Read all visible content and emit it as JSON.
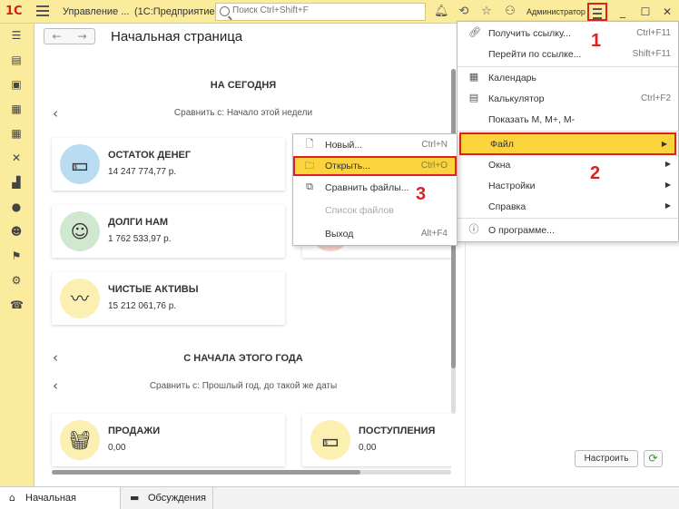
{
  "titlebar": {
    "app_name": "Управление ...",
    "app_platform": "(1С:Предприятие)",
    "search_placeholder": "Поиск Ctrl+Shift+F",
    "user": "Администратор"
  },
  "sidebar": {
    "items": [
      {
        "icon": "menu-list-icon"
      },
      {
        "icon": "contacts-icon"
      },
      {
        "icon": "briefcase-icon"
      },
      {
        "icon": "building-icon"
      },
      {
        "icon": "warehouse-grid-icon"
      },
      {
        "icon": "tools-icon"
      },
      {
        "icon": "factory-icon"
      },
      {
        "icon": "money-icon"
      },
      {
        "icon": "users-icon"
      },
      {
        "icon": "flag-icon"
      },
      {
        "icon": "gear-icon"
      },
      {
        "icon": "phone-icon"
      }
    ]
  },
  "page": {
    "title": "Начальная страница"
  },
  "today": {
    "title": "НА СЕГОДНЯ",
    "compare": "Сравнить с: Начало этой недели",
    "cards": [
      {
        "title": "ОСТАТОК ДЕНЕГ",
        "value": "14 247 774,77 р."
      },
      {
        "title": "ДОЛГИ НАМ",
        "value": "1 762 533,97 р."
      },
      {
        "title": "ЧИСТЫЕ АКТИВЫ",
        "value": "15 212 061,76 р."
      }
    ]
  },
  "year": {
    "title": "С НАЧАЛА ЭТОГО ГОДА",
    "compare": "Сравнить с: Прошлый год, до такой же даты",
    "cards": [
      {
        "title": "ПРОДАЖИ",
        "value": "0,00"
      },
      {
        "title": "ПОСТУПЛЕНИЯ",
        "value": "0,00"
      }
    ]
  },
  "buttons": {
    "setup": "Настроить"
  },
  "main_menu": {
    "items": [
      {
        "label": "Получить ссылку...",
        "shortcut": "Ctrl+F11"
      },
      {
        "label": "Перейти по ссылке...",
        "shortcut": "Shift+F11"
      },
      {
        "label": "Календарь",
        "shortcut": ""
      },
      {
        "label": "Калькулятор",
        "shortcut": "Ctrl+F2"
      },
      {
        "label": "Показать М, М+, М-",
        "shortcut": ""
      },
      {
        "label": "Файл",
        "shortcut": ""
      },
      {
        "label": "Окна",
        "shortcut": ""
      },
      {
        "label": "Настройки",
        "shortcut": ""
      },
      {
        "label": "Справка",
        "shortcut": ""
      },
      {
        "label": "О программе...",
        "shortcut": ""
      }
    ]
  },
  "file_menu": {
    "items": [
      {
        "label": "Новый...",
        "shortcut": "Ctrl+N"
      },
      {
        "label": "Открыть...",
        "shortcut": "Ctrl+O"
      },
      {
        "label": "Сравнить файлы...",
        "shortcut": ""
      },
      {
        "label": "Список файлов",
        "shortcut": ""
      },
      {
        "label": "Выход",
        "shortcut": "Alt+F4"
      }
    ]
  },
  "bottom_tabs": [
    {
      "label": "Начальная страница"
    },
    {
      "label": "Обсуждения"
    }
  ],
  "annotations": [
    "1",
    "2",
    "3"
  ],
  "colors": {
    "panel": "#fbeb9c",
    "highlight": "#fbd33d",
    "marker": "#e02020"
  }
}
